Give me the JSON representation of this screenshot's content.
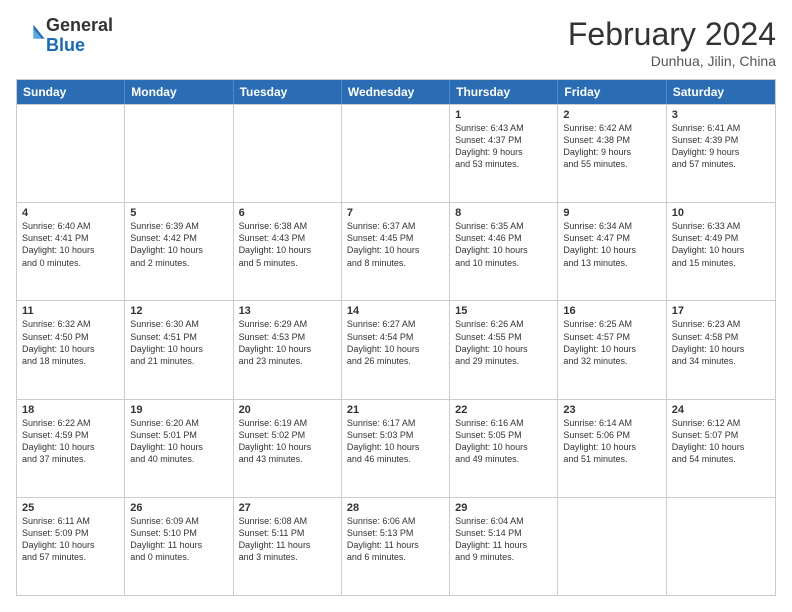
{
  "header": {
    "logo_line1": "General",
    "logo_line2": "Blue",
    "title": "February 2024",
    "subtitle": "Dunhua, Jilin, China"
  },
  "days_of_week": [
    "Sunday",
    "Monday",
    "Tuesday",
    "Wednesday",
    "Thursday",
    "Friday",
    "Saturday"
  ],
  "weeks": [
    [
      {
        "day": "",
        "info": ""
      },
      {
        "day": "",
        "info": ""
      },
      {
        "day": "",
        "info": ""
      },
      {
        "day": "",
        "info": ""
      },
      {
        "day": "1",
        "info": "Sunrise: 6:43 AM\nSunset: 4:37 PM\nDaylight: 9 hours\nand 53 minutes."
      },
      {
        "day": "2",
        "info": "Sunrise: 6:42 AM\nSunset: 4:38 PM\nDaylight: 9 hours\nand 55 minutes."
      },
      {
        "day": "3",
        "info": "Sunrise: 6:41 AM\nSunset: 4:39 PM\nDaylight: 9 hours\nand 57 minutes."
      }
    ],
    [
      {
        "day": "4",
        "info": "Sunrise: 6:40 AM\nSunset: 4:41 PM\nDaylight: 10 hours\nand 0 minutes."
      },
      {
        "day": "5",
        "info": "Sunrise: 6:39 AM\nSunset: 4:42 PM\nDaylight: 10 hours\nand 2 minutes."
      },
      {
        "day": "6",
        "info": "Sunrise: 6:38 AM\nSunset: 4:43 PM\nDaylight: 10 hours\nand 5 minutes."
      },
      {
        "day": "7",
        "info": "Sunrise: 6:37 AM\nSunset: 4:45 PM\nDaylight: 10 hours\nand 8 minutes."
      },
      {
        "day": "8",
        "info": "Sunrise: 6:35 AM\nSunset: 4:46 PM\nDaylight: 10 hours\nand 10 minutes."
      },
      {
        "day": "9",
        "info": "Sunrise: 6:34 AM\nSunset: 4:47 PM\nDaylight: 10 hours\nand 13 minutes."
      },
      {
        "day": "10",
        "info": "Sunrise: 6:33 AM\nSunset: 4:49 PM\nDaylight: 10 hours\nand 15 minutes."
      }
    ],
    [
      {
        "day": "11",
        "info": "Sunrise: 6:32 AM\nSunset: 4:50 PM\nDaylight: 10 hours\nand 18 minutes."
      },
      {
        "day": "12",
        "info": "Sunrise: 6:30 AM\nSunset: 4:51 PM\nDaylight: 10 hours\nand 21 minutes."
      },
      {
        "day": "13",
        "info": "Sunrise: 6:29 AM\nSunset: 4:53 PM\nDaylight: 10 hours\nand 23 minutes."
      },
      {
        "day": "14",
        "info": "Sunrise: 6:27 AM\nSunset: 4:54 PM\nDaylight: 10 hours\nand 26 minutes."
      },
      {
        "day": "15",
        "info": "Sunrise: 6:26 AM\nSunset: 4:55 PM\nDaylight: 10 hours\nand 29 minutes."
      },
      {
        "day": "16",
        "info": "Sunrise: 6:25 AM\nSunset: 4:57 PM\nDaylight: 10 hours\nand 32 minutes."
      },
      {
        "day": "17",
        "info": "Sunrise: 6:23 AM\nSunset: 4:58 PM\nDaylight: 10 hours\nand 34 minutes."
      }
    ],
    [
      {
        "day": "18",
        "info": "Sunrise: 6:22 AM\nSunset: 4:59 PM\nDaylight: 10 hours\nand 37 minutes."
      },
      {
        "day": "19",
        "info": "Sunrise: 6:20 AM\nSunset: 5:01 PM\nDaylight: 10 hours\nand 40 minutes."
      },
      {
        "day": "20",
        "info": "Sunrise: 6:19 AM\nSunset: 5:02 PM\nDaylight: 10 hours\nand 43 minutes."
      },
      {
        "day": "21",
        "info": "Sunrise: 6:17 AM\nSunset: 5:03 PM\nDaylight: 10 hours\nand 46 minutes."
      },
      {
        "day": "22",
        "info": "Sunrise: 6:16 AM\nSunset: 5:05 PM\nDaylight: 10 hours\nand 49 minutes."
      },
      {
        "day": "23",
        "info": "Sunrise: 6:14 AM\nSunset: 5:06 PM\nDaylight: 10 hours\nand 51 minutes."
      },
      {
        "day": "24",
        "info": "Sunrise: 6:12 AM\nSunset: 5:07 PM\nDaylight: 10 hours\nand 54 minutes."
      }
    ],
    [
      {
        "day": "25",
        "info": "Sunrise: 6:11 AM\nSunset: 5:09 PM\nDaylight: 10 hours\nand 57 minutes."
      },
      {
        "day": "26",
        "info": "Sunrise: 6:09 AM\nSunset: 5:10 PM\nDaylight: 11 hours\nand 0 minutes."
      },
      {
        "day": "27",
        "info": "Sunrise: 6:08 AM\nSunset: 5:11 PM\nDaylight: 11 hours\nand 3 minutes."
      },
      {
        "day": "28",
        "info": "Sunrise: 6:06 AM\nSunset: 5:13 PM\nDaylight: 11 hours\nand 6 minutes."
      },
      {
        "day": "29",
        "info": "Sunrise: 6:04 AM\nSunset: 5:14 PM\nDaylight: 11 hours\nand 9 minutes."
      },
      {
        "day": "",
        "info": ""
      },
      {
        "day": "",
        "info": ""
      }
    ]
  ]
}
